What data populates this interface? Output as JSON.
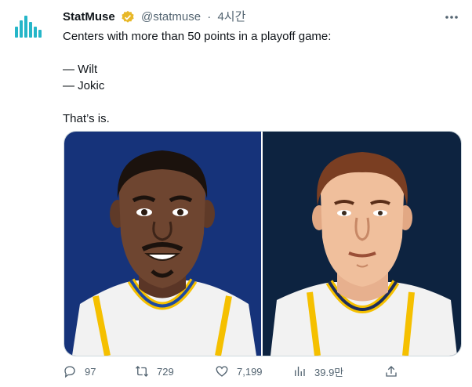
{
  "tweet": {
    "display_name": "StatMuse",
    "handle": "@statmuse",
    "separator": "·",
    "time": "4시간",
    "lines": [
      "Centers with more than 50 points in a playoff game:",
      "",
      "— Wilt",
      "— Jokic",
      "",
      "That’s is."
    ]
  },
  "actions": {
    "replies": "97",
    "retweets": "729",
    "likes": "7,199",
    "views": "39.9만"
  },
  "colors": {
    "brand": "#1d9bf0",
    "muted": "#536471",
    "verified_gold": "#e8b829",
    "panel_left_bg": "#16337a",
    "panel_right_bg": "#0d2340"
  },
  "icons": [
    "statmuse-logo",
    "verified-badge-icon",
    "more-icon",
    "reply-icon",
    "retweet-icon",
    "like-icon",
    "views-icon",
    "share-icon"
  ]
}
